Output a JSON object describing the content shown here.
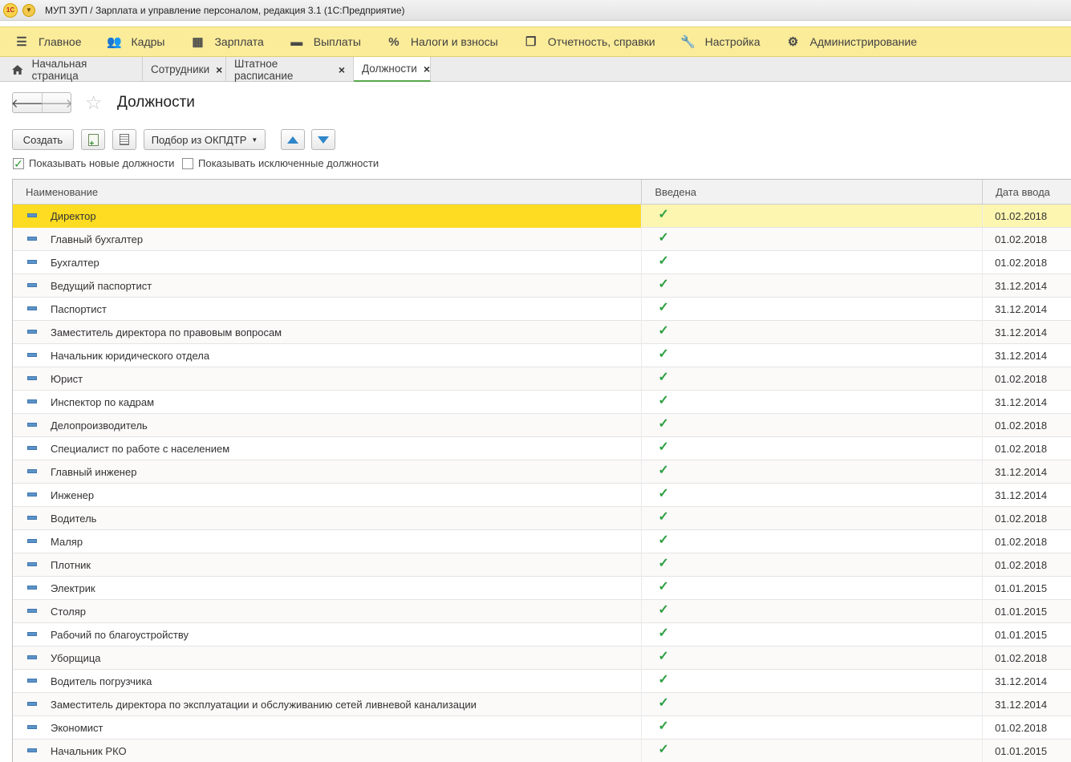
{
  "window": {
    "title": "МУП ЗУП / Зарплата и управление персоналом, редакция 3.1  (1С:Предприятие)",
    "logo_text": "1С"
  },
  "sections": [
    {
      "label": "Главное",
      "icon": "hamburger-icon"
    },
    {
      "label": "Кадры",
      "icon": "people-icon"
    },
    {
      "label": "Зарплата",
      "icon": "calculator-icon"
    },
    {
      "label": "Выплаты",
      "icon": "wallet-icon"
    },
    {
      "label": "Налоги и взносы",
      "icon": "percent-icon"
    },
    {
      "label": "Отчетность, справки",
      "icon": "documents-icon"
    },
    {
      "label": "Настройка",
      "icon": "wrench-icon"
    },
    {
      "label": "Администрирование",
      "icon": "gear-icon"
    }
  ],
  "tabs": [
    {
      "label": "Начальная страница"
    },
    {
      "label": "Сотрудники"
    },
    {
      "label": "Штатное расписание"
    },
    {
      "label": "Должности"
    }
  ],
  "form": {
    "title": "Должности"
  },
  "toolbar": {
    "create_label": "Создать",
    "pick_label": "Подбор из ОКПДТР"
  },
  "filters": {
    "show_new_label": "Показывать новые должности",
    "show_new_checked": true,
    "show_excluded_label": "Показывать исключенные должности",
    "show_excluded_checked": false
  },
  "grid": {
    "columns": [
      "Наименование",
      "Введена",
      "Дата ввода"
    ],
    "rows": [
      {
        "name": "Директор",
        "introduced": true,
        "date": "01.02.2018"
      },
      {
        "name": "Главный бухгалтер",
        "introduced": true,
        "date": "01.02.2018"
      },
      {
        "name": "Бухгалтер",
        "introduced": true,
        "date": "01.02.2018"
      },
      {
        "name": "Ведущий паспортист",
        "introduced": true,
        "date": "31.12.2014"
      },
      {
        "name": "Паспортист",
        "introduced": true,
        "date": "31.12.2014"
      },
      {
        "name": "Заместитель директора по правовым вопросам",
        "introduced": true,
        "date": "31.12.2014"
      },
      {
        "name": "Начальник юридического отдела",
        "introduced": true,
        "date": "31.12.2014"
      },
      {
        "name": "Юрист",
        "introduced": true,
        "date": "01.02.2018"
      },
      {
        "name": "Инспектор по кадрам",
        "introduced": true,
        "date": "31.12.2014"
      },
      {
        "name": "Делопроизводитель",
        "introduced": true,
        "date": "01.02.2018"
      },
      {
        "name": "Специалист по работе с населением",
        "introduced": true,
        "date": "01.02.2018"
      },
      {
        "name": "Главный инженер",
        "introduced": true,
        "date": "31.12.2014"
      },
      {
        "name": "Инженер",
        "introduced": true,
        "date": "31.12.2014"
      },
      {
        "name": "Водитель",
        "introduced": true,
        "date": "01.02.2018"
      },
      {
        "name": "Маляр",
        "introduced": true,
        "date": "01.02.2018"
      },
      {
        "name": "Плотник",
        "introduced": true,
        "date": "01.02.2018"
      },
      {
        "name": "Электрик",
        "introduced": true,
        "date": "01.01.2015"
      },
      {
        "name": "Столяр",
        "introduced": true,
        "date": "01.01.2015"
      },
      {
        "name": "Рабочий по благоустройству",
        "introduced": true,
        "date": "01.01.2015"
      },
      {
        "name": "Уборщица",
        "introduced": true,
        "date": "01.02.2018"
      },
      {
        "name": "Водитель погрузчика",
        "introduced": true,
        "date": "31.12.2014"
      },
      {
        "name": "Заместитель директора по эксплуатации и обслуживанию сетей ливневой канализации",
        "introduced": true,
        "date": "31.12.2014"
      },
      {
        "name": "Экономист",
        "introduced": true,
        "date": "01.02.2018"
      },
      {
        "name": "Начальник РКО",
        "introduced": true,
        "date": "01.01.2015"
      }
    ]
  },
  "colors": {
    "section_bar": "#fbec9a",
    "selected_cell": "#fedc22",
    "selected_row": "#fdf6b0",
    "check": "#2ea043",
    "active_tab_underline": "#57a84a"
  }
}
